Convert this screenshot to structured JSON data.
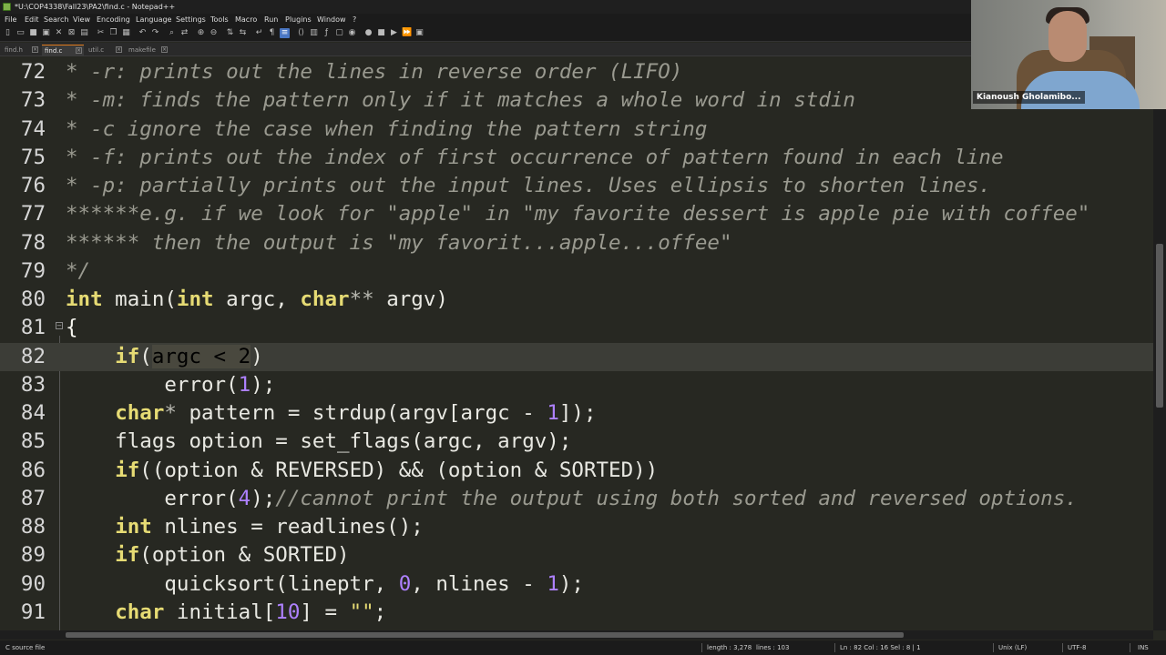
{
  "window": {
    "title": "*U:\\COP4338\\Fall23\\PA2\\find.c - Notepad++"
  },
  "menu": [
    "File",
    "Edit",
    "Search",
    "View",
    "Encoding",
    "Language",
    "Settings",
    "Tools",
    "Macro",
    "Run",
    "Plugins",
    "Window",
    "?"
  ],
  "tabs": [
    {
      "label": "find.h",
      "active": false
    },
    {
      "label": "find.c",
      "active": true
    },
    {
      "label": "util.c",
      "active": false
    },
    {
      "label": "makefile",
      "active": false
    }
  ],
  "editor": {
    "current_line": 82,
    "lines": [
      {
        "n": "72",
        "tokens": [
          [
            "cm",
            "* -r: prints out the lines in reverse order (LIFO)"
          ]
        ]
      },
      {
        "n": "73",
        "tokens": [
          [
            "cm",
            "* -m: finds the pattern only if it matches a whole word in stdin"
          ]
        ]
      },
      {
        "n": "74",
        "tokens": [
          [
            "cm",
            "* -c ignore the case when finding the pattern string"
          ]
        ]
      },
      {
        "n": "75",
        "tokens": [
          [
            "cm",
            "* -f: prints out the index of first occurrence of pattern found in each line"
          ]
        ]
      },
      {
        "n": "76",
        "tokens": [
          [
            "cm",
            "* -p: partially prints out the input lines. Uses ellipsis to shorten lines."
          ]
        ]
      },
      {
        "n": "77",
        "tokens": [
          [
            "cm",
            "******e.g. if we look for \"apple\" in \"my favorite dessert is apple pie with coffee\""
          ]
        ]
      },
      {
        "n": "78",
        "tokens": [
          [
            "cm",
            "****** then the output is \"my favorit...apple...offee\""
          ]
        ]
      },
      {
        "n": "79",
        "tokens": [
          [
            "cm",
            "*/"
          ]
        ]
      },
      {
        "n": "80",
        "tokens": [
          [
            "kw",
            "int"
          ],
          [
            "plain",
            " main("
          ],
          [
            "kw",
            "int"
          ],
          [
            "plain",
            " argc, "
          ],
          [
            "kw",
            "char"
          ],
          [
            "op",
            "**"
          ],
          [
            "plain",
            " argv)"
          ]
        ]
      },
      {
        "n": "81",
        "tokens": [
          [
            "brace",
            "{"
          ]
        ]
      },
      {
        "n": "82",
        "tokens": [
          [
            "plain",
            "    "
          ],
          [
            "kw",
            "if"
          ],
          [
            "plain",
            "("
          ],
          [
            "sel",
            "argc < 2"
          ],
          [
            "plain",
            ")"
          ]
        ]
      },
      {
        "n": "83",
        "tokens": [
          [
            "plain",
            "        error("
          ],
          [
            "num",
            "1"
          ],
          [
            "plain",
            ");"
          ]
        ]
      },
      {
        "n": "84",
        "tokens": [
          [
            "plain",
            "    "
          ],
          [
            "kw",
            "char"
          ],
          [
            "op",
            "*"
          ],
          [
            "plain",
            " pattern = strdup(argv[argc - "
          ],
          [
            "num",
            "1"
          ],
          [
            "plain",
            "]);"
          ]
        ]
      },
      {
        "n": "85",
        "tokens": [
          [
            "plain",
            "    flags option = set_flags(argc, argv);"
          ]
        ]
      },
      {
        "n": "86",
        "tokens": [
          [
            "plain",
            "    "
          ],
          [
            "kw",
            "if"
          ],
          [
            "plain",
            "((option & REVERSED) && (option & SORTED))"
          ]
        ]
      },
      {
        "n": "87",
        "tokens": [
          [
            "plain",
            "        error("
          ],
          [
            "num",
            "4"
          ],
          [
            "plain",
            ");"
          ],
          [
            "cm",
            "//cannot print the output using both sorted and reversed options."
          ]
        ]
      },
      {
        "n": "88",
        "tokens": [
          [
            "plain",
            "    "
          ],
          [
            "kw",
            "int"
          ],
          [
            "plain",
            " nlines = readlines();"
          ]
        ]
      },
      {
        "n": "89",
        "tokens": [
          [
            "plain",
            "    "
          ],
          [
            "kw",
            "if"
          ],
          [
            "plain",
            "(option & SORTED)"
          ]
        ]
      },
      {
        "n": "90",
        "tokens": [
          [
            "plain",
            "        quicksort(lineptr, "
          ],
          [
            "num",
            "0"
          ],
          [
            "plain",
            ", nlines - "
          ],
          [
            "num",
            "1"
          ],
          [
            "plain",
            ");"
          ]
        ]
      },
      {
        "n": "91",
        "tokens": [
          [
            "plain",
            "    "
          ],
          [
            "kw",
            "char"
          ],
          [
            "plain",
            " initial["
          ],
          [
            "num",
            "10"
          ],
          [
            "plain",
            "] = "
          ],
          [
            "str",
            "\"\""
          ],
          [
            "plain",
            ";"
          ]
        ]
      }
    ]
  },
  "status": {
    "file_type": "C source file",
    "length": "length : 3,278",
    "lines": "lines : 103",
    "position": "Ln : 82   Col : 16   Sel : 8 | 1",
    "eol": "Unix (LF)",
    "encoding": "UTF-8",
    "mode": "INS"
  },
  "webcam": {
    "name": "Kianoush Gholamibo..."
  },
  "colors": {
    "editor_bg": "#272822",
    "comment": "#9a9a90",
    "keyword": "#e6db74",
    "number": "#ae81ff",
    "current_line": "#3c3d37"
  }
}
